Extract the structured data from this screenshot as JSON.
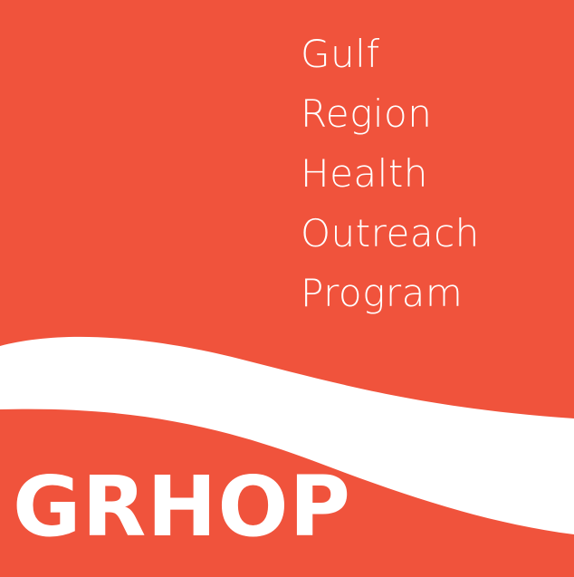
{
  "logo": {
    "name_lines": [
      "Gulf",
      "Region",
      "Health",
      "Outreach",
      "Program"
    ],
    "acronym": "GRHOP",
    "colors": {
      "background": "#F0533C",
      "wave": "#FFFFFF",
      "text": "#FFFFFF"
    }
  }
}
